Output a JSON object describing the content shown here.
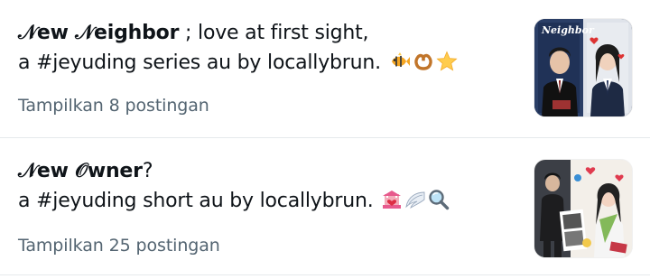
{
  "items": [
    {
      "title_bold": "𝒩ew 𝒩eighbor",
      "title_rest": " ; love at first sight,",
      "subtitle": "a #jeyuding series au by locallybrun.",
      "emojis": [
        "tropical-fish-emoji",
        "pretzel-emoji",
        "star-emoji"
      ],
      "show_more": "Tampilkan 8 postingan",
      "thumb_caption": "Neighbor"
    },
    {
      "title_bold": "𝒩ew 𝒪wner",
      "title_rest": "?",
      "subtitle": "a #jeyuding short au by locallybrun.",
      "emojis": [
        "love-hotel-emoji",
        "wing-emoji",
        "magnifying-glass-emoji"
      ],
      "show_more": "Tampilkan 25 postingan"
    }
  ]
}
